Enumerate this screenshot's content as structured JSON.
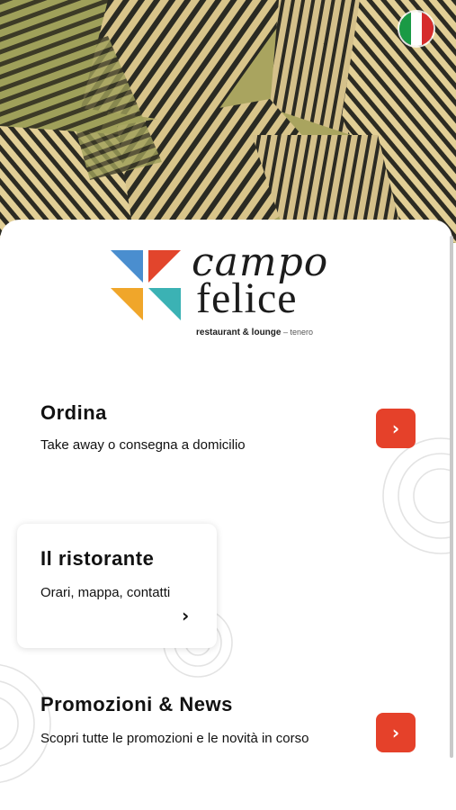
{
  "header": {
    "language_flag": "italian-flag-icon",
    "flag_colors": [
      "#1a9a45",
      "#ffffff",
      "#d62b2b"
    ]
  },
  "brand": {
    "name_line1": "campo",
    "name_line2": "felice",
    "tagline": "restaurant & lounge",
    "location": "tenero",
    "mark_colors": [
      "#4a8ecf",
      "#e2452c",
      "#f0a62a",
      "#3bb2b4"
    ]
  },
  "menu": [
    {
      "title": "Ordina",
      "subtitle": "Take away o consegna a domicilio",
      "arrow": "chevron-right-icon"
    },
    {
      "title": "Il ristorante",
      "subtitle": "Orari, mappa, contatti",
      "arrow": "chevron-right-icon"
    },
    {
      "title": "Promozioni & News",
      "subtitle": "Scopri tutte le promozioni e le novità in corso",
      "arrow": "chevron-right-icon"
    }
  ],
  "colors": {
    "accent": "#e5412a"
  },
  "chevron_glyph": "›"
}
